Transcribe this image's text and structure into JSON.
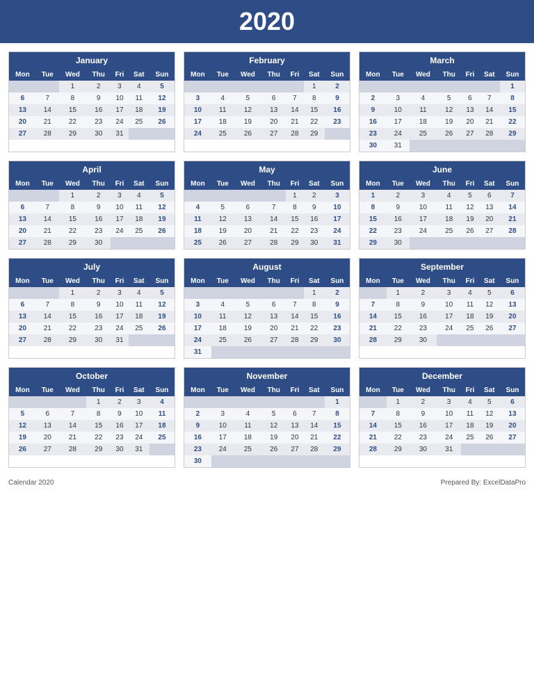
{
  "title": "2020",
  "footer": {
    "left": "Calendar 2020",
    "right": "Prepared By: ExcelDataPro"
  },
  "days": [
    "Mon",
    "Tue",
    "Wed",
    "Thu",
    "Fri",
    "Sat",
    "Sun"
  ],
  "months": [
    {
      "name": "January",
      "weeks": [
        [
          "",
          "",
          "1",
          "2",
          "3",
          "4",
          "5"
        ],
        [
          "6",
          "7",
          "8",
          "9",
          "10",
          "11",
          "12"
        ],
        [
          "13",
          "14",
          "15",
          "16",
          "17",
          "18",
          "19"
        ],
        [
          "20",
          "21",
          "22",
          "23",
          "24",
          "25",
          "26"
        ],
        [
          "27",
          "28",
          "29",
          "30",
          "31",
          "",
          ""
        ]
      ]
    },
    {
      "name": "February",
      "weeks": [
        [
          "",
          "",
          "",
          "",
          "",
          "1",
          "2"
        ],
        [
          "3",
          "4",
          "5",
          "6",
          "7",
          "8",
          "9"
        ],
        [
          "10",
          "11",
          "12",
          "13",
          "14",
          "15",
          "16"
        ],
        [
          "17",
          "18",
          "19",
          "20",
          "21",
          "22",
          "23"
        ],
        [
          "24",
          "25",
          "26",
          "27",
          "28",
          "29",
          ""
        ]
      ]
    },
    {
      "name": "March",
      "weeks": [
        [
          "",
          "",
          "",
          "",
          "",
          "",
          "1"
        ],
        [
          "2",
          "3",
          "4",
          "5",
          "6",
          "7",
          "8"
        ],
        [
          "9",
          "10",
          "11",
          "12",
          "13",
          "14",
          "15"
        ],
        [
          "16",
          "17",
          "18",
          "19",
          "20",
          "21",
          "22"
        ],
        [
          "23",
          "24",
          "25",
          "26",
          "27",
          "28",
          "29"
        ],
        [
          "30",
          "31",
          "",
          "",
          "",
          "",
          ""
        ]
      ]
    },
    {
      "name": "April",
      "weeks": [
        [
          "",
          "",
          "1",
          "2",
          "3",
          "4",
          "5"
        ],
        [
          "6",
          "7",
          "8",
          "9",
          "10",
          "11",
          "12"
        ],
        [
          "13",
          "14",
          "15",
          "16",
          "17",
          "18",
          "19"
        ],
        [
          "20",
          "21",
          "22",
          "23",
          "24",
          "25",
          "26"
        ],
        [
          "27",
          "28",
          "29",
          "30",
          "",
          "",
          ""
        ]
      ]
    },
    {
      "name": "May",
      "weeks": [
        [
          "",
          "",
          "",
          "",
          "1",
          "2",
          "3"
        ],
        [
          "4",
          "5",
          "6",
          "7",
          "8",
          "9",
          "10"
        ],
        [
          "11",
          "12",
          "13",
          "14",
          "15",
          "16",
          "17"
        ],
        [
          "18",
          "19",
          "20",
          "21",
          "22",
          "23",
          "24"
        ],
        [
          "25",
          "26",
          "27",
          "28",
          "29",
          "30",
          "31"
        ]
      ]
    },
    {
      "name": "June",
      "weeks": [
        [
          "1",
          "2",
          "3",
          "4",
          "5",
          "6",
          "7"
        ],
        [
          "8",
          "9",
          "10",
          "11",
          "12",
          "13",
          "14"
        ],
        [
          "15",
          "16",
          "17",
          "18",
          "19",
          "20",
          "21"
        ],
        [
          "22",
          "23",
          "24",
          "25",
          "26",
          "27",
          "28"
        ],
        [
          "29",
          "30",
          "",
          "",
          "",
          "",
          ""
        ]
      ]
    },
    {
      "name": "July",
      "weeks": [
        [
          "",
          "",
          "1",
          "2",
          "3",
          "4",
          "5"
        ],
        [
          "6",
          "7",
          "8",
          "9",
          "10",
          "11",
          "12"
        ],
        [
          "13",
          "14",
          "15",
          "16",
          "17",
          "18",
          "19"
        ],
        [
          "20",
          "21",
          "22",
          "23",
          "24",
          "25",
          "26"
        ],
        [
          "27",
          "28",
          "29",
          "30",
          "31",
          "",
          ""
        ]
      ]
    },
    {
      "name": "August",
      "weeks": [
        [
          "",
          "",
          "",
          "",
          "",
          "1",
          "2"
        ],
        [
          "3",
          "4",
          "5",
          "6",
          "7",
          "8",
          "9"
        ],
        [
          "10",
          "11",
          "12",
          "13",
          "14",
          "15",
          "16"
        ],
        [
          "17",
          "18",
          "19",
          "20",
          "21",
          "22",
          "23"
        ],
        [
          "24",
          "25",
          "26",
          "27",
          "28",
          "29",
          "30"
        ],
        [
          "31",
          "",
          "",
          "",
          "",
          "",
          ""
        ]
      ]
    },
    {
      "name": "September",
      "weeks": [
        [
          "",
          "1",
          "2",
          "3",
          "4",
          "5",
          "6"
        ],
        [
          "7",
          "8",
          "9",
          "10",
          "11",
          "12",
          "13"
        ],
        [
          "14",
          "15",
          "16",
          "17",
          "18",
          "19",
          "20"
        ],
        [
          "21",
          "22",
          "23",
          "24",
          "25",
          "26",
          "27"
        ],
        [
          "28",
          "29",
          "30",
          "",
          "",
          "",
          ""
        ]
      ]
    },
    {
      "name": "October",
      "weeks": [
        [
          "",
          "",
          "",
          "1",
          "2",
          "3",
          "4"
        ],
        [
          "5",
          "6",
          "7",
          "8",
          "9",
          "10",
          "11"
        ],
        [
          "12",
          "13",
          "14",
          "15",
          "16",
          "17",
          "18"
        ],
        [
          "19",
          "20",
          "21",
          "22",
          "23",
          "24",
          "25"
        ],
        [
          "26",
          "27",
          "28",
          "29",
          "30",
          "31",
          ""
        ]
      ]
    },
    {
      "name": "November",
      "weeks": [
        [
          "",
          "",
          "",
          "",
          "",
          "",
          "1"
        ],
        [
          "2",
          "3",
          "4",
          "5",
          "6",
          "7",
          "8"
        ],
        [
          "9",
          "10",
          "11",
          "12",
          "13",
          "14",
          "15"
        ],
        [
          "16",
          "17",
          "18",
          "19",
          "20",
          "21",
          "22"
        ],
        [
          "23",
          "24",
          "25",
          "26",
          "27",
          "28",
          "29"
        ],
        [
          "30",
          "",
          "",
          "",
          "",
          "",
          ""
        ]
      ]
    },
    {
      "name": "December",
      "weeks": [
        [
          "",
          "1",
          "2",
          "3",
          "4",
          "5",
          "6"
        ],
        [
          "7",
          "8",
          "9",
          "10",
          "11",
          "12",
          "13"
        ],
        [
          "14",
          "15",
          "16",
          "17",
          "18",
          "19",
          "20"
        ],
        [
          "21",
          "22",
          "23",
          "24",
          "25",
          "26",
          "27"
        ],
        [
          "28",
          "29",
          "30",
          "31",
          "",
          "",
          ""
        ]
      ]
    }
  ]
}
